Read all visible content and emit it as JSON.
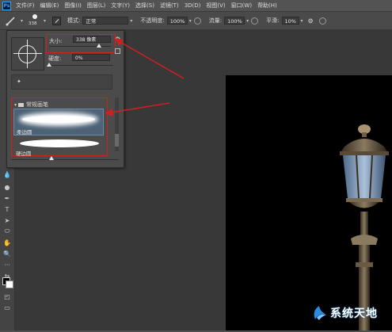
{
  "menubar": {
    "app_logo": "Ps",
    "items": [
      "文件(F)",
      "编辑(E)",
      "图像(I)",
      "图层(L)",
      "文字(Y)",
      "选择(S)",
      "滤镜(T)",
      "3D(D)",
      "视图(V)",
      "窗口(W)",
      "帮助(H)"
    ]
  },
  "options_bar": {
    "brush_size_preview": "338",
    "mode_label": "模式:",
    "mode_value": "正常",
    "opacity_label": "不透明度:",
    "opacity_value": "100%",
    "flow_label": "流量:",
    "flow_value": "100%",
    "smoothing_label": "平滑:",
    "smoothing_value": "10%"
  },
  "brush_panel": {
    "size_label": "大小:",
    "size_value": "338 像素",
    "hardness_label": "硬度:",
    "hardness_value": "0%",
    "preset_group": "常规画笔",
    "brush_1_name": "柔边圆",
    "brush_2_name": "硬边圆"
  },
  "watermark": {
    "text": "系统天地"
  },
  "colors": {
    "accent": "#31a8ff",
    "highlight_box": "#d21f1f",
    "selected_brush": "#4d6276"
  }
}
